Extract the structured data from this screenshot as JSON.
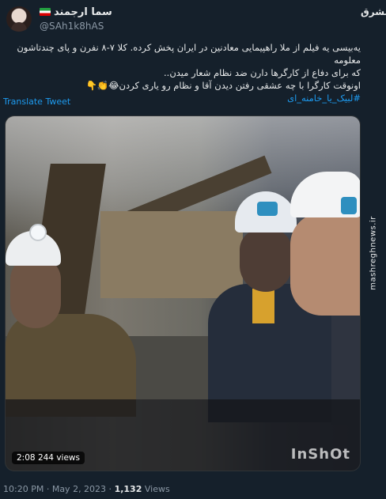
{
  "author": {
    "display_name": "سما ارجمند",
    "handle": "@SAh1k8hAS",
    "avatar_icon": "profile-avatar"
  },
  "tweet": {
    "text_line1": "یه‌بیسی یه فیلم از ملا راهپیمایی معادنین در ایران پخش کرده. کلا ۷-۸ نفرن و پای چندتاشون معلومه",
    "text_line2": "که برای دفاع از کارگرها دارن ضد نظام شعار میدن..",
    "text_line3": "اونوقت کارگرا با چه عشقی رفتن دیدن آقا و نظام رو یاری کردن😂👏👇",
    "hashtag": "#لبیک_یا_خامنه_ای",
    "translate_label": "Translate Tweet"
  },
  "media": {
    "duration": "2:08",
    "views": "244 views",
    "watermark": "InShOt"
  },
  "footer": {
    "time": "10:20 PM",
    "date": "May 2, 2023",
    "views_count": "1,132",
    "views_label": "Views"
  },
  "brand": {
    "logo": "مشرق",
    "url": "mashreghnews.ir"
  },
  "colors": {
    "background": "#15202b",
    "link": "#1d9bf0",
    "muted": "#8b98a5"
  }
}
